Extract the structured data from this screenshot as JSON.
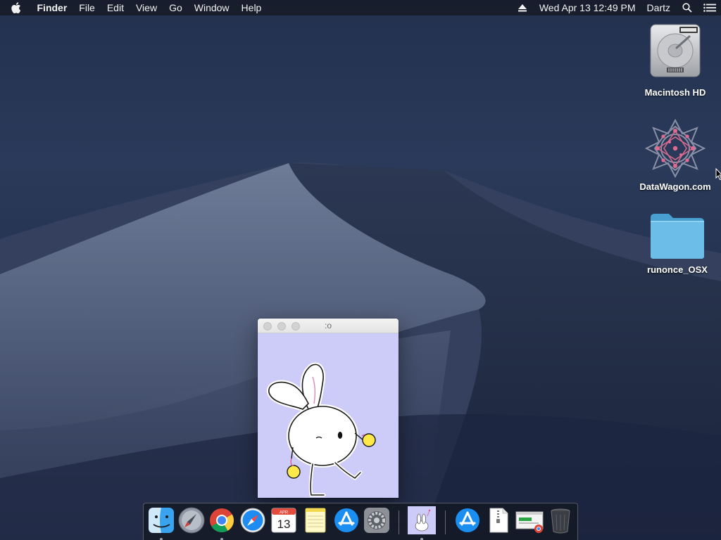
{
  "menubar": {
    "apple_icon": "apple-icon",
    "app_name": "Finder",
    "menus": [
      "File",
      "Edit",
      "View",
      "Go",
      "Window",
      "Help"
    ],
    "eject_icon": "eject-icon",
    "datetime": "Wed Apr 13  12:49 PM",
    "user": "Dartz",
    "search_icon": "spotlight-search-icon",
    "notification_icon": "notification-center-icon"
  },
  "desktop": {
    "icons": [
      {
        "label": "Macintosh HD",
        "icon": "hard-drive-icon"
      },
      {
        "label": "DataWagon.com",
        "icon": "datawagon-logo-icon"
      },
      {
        "label": "runonce_OSX",
        "icon": "folder-icon"
      }
    ]
  },
  "window": {
    "title": ":o",
    "background_color": "#cdcbf8",
    "image": "bunny-character-image"
  },
  "dock": {
    "calendar_month": "APR",
    "calendar_day": "13",
    "apps": [
      {
        "name": "Finder",
        "icon": "finder-icon",
        "running": true
      },
      {
        "name": "Launchpad",
        "icon": "launchpad-icon",
        "running": false
      },
      {
        "name": "Google Chrome",
        "icon": "chrome-icon",
        "running": true
      },
      {
        "name": "Safari",
        "icon": "safari-icon",
        "running": false
      },
      {
        "name": "Calendar",
        "icon": "calendar-icon",
        "running": false
      },
      {
        "name": "Notes",
        "icon": "notes-icon",
        "running": false
      },
      {
        "name": "App Store",
        "icon": "app-store-icon",
        "running": false
      },
      {
        "name": "System Preferences",
        "icon": "system-preferences-icon",
        "running": false
      },
      {
        "name": "Bunny App",
        "icon": "bunny-app-icon",
        "running": true
      }
    ],
    "stack_items": [
      {
        "name": "Applications",
        "icon": "applications-stack-icon"
      },
      {
        "name": "Zip Archive",
        "icon": "zip-file-icon"
      },
      {
        "name": "Chrome Document",
        "icon": "chrome-document-icon"
      },
      {
        "name": "Trash",
        "icon": "trash-icon"
      }
    ]
  }
}
